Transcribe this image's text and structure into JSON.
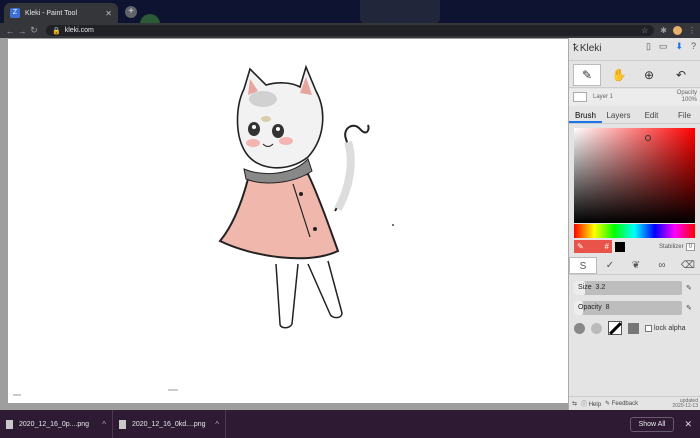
{
  "browser": {
    "tab_title": "Kleki - Paint Tool",
    "tab_favicon": "Z",
    "url": "kleki.com",
    "nav": {
      "back": "←",
      "forward": "→",
      "reload": "↻"
    },
    "omni_icons": {
      "lock": "🔒",
      "star": "☆"
    },
    "ext_icons": [
      "puzzle-icon",
      "menu-dots-icon"
    ]
  },
  "app": {
    "brand": "Kleki",
    "layer": {
      "name": "Layer 1",
      "opacity_label": "Opacity",
      "opacity_value": "100%"
    },
    "tabs": [
      "Brush",
      "Layers",
      "Edit",
      "File"
    ],
    "active_tab": "Brush",
    "color": {
      "primary": "#e8544a",
      "secondary": "#000000",
      "hex_glyph": "#"
    },
    "stabilizer": {
      "label": "Stabilizer",
      "value": "0"
    },
    "size": {
      "label": "Size",
      "value": "3.2",
      "fraction": 0.1
    },
    "opacity": {
      "label": "Opacity",
      "value": "8",
      "fraction": 0.08
    },
    "lock_alpha": "lock alpha",
    "footer": {
      "help": "Help",
      "feedback": "Feedback",
      "updated_label": "updated",
      "updated_date": "2020-12-13"
    }
  },
  "downloads": {
    "items": [
      "2020_12_16_0p....png",
      "2020_12_16_0kd....png"
    ],
    "show_all": "Show All"
  }
}
